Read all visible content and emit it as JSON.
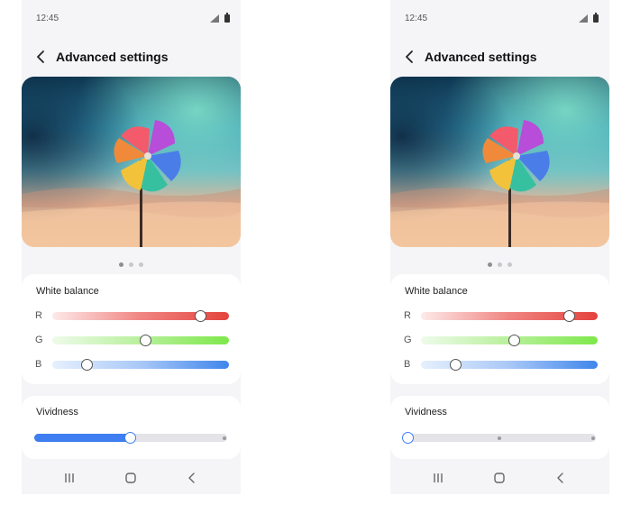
{
  "screens": [
    {
      "id": "left",
      "status_time": "12:45",
      "title": "Advanced settings",
      "white_balance": {
        "label": "White balance",
        "channels": [
          {
            "label": "R",
            "value": 0.84
          },
          {
            "label": "G",
            "value": 0.53
          },
          {
            "label": "B",
            "value": 0.2
          }
        ]
      },
      "vividness": {
        "label": "Vividness",
        "value": 0.5,
        "stops": 2
      }
    },
    {
      "id": "right",
      "status_time": "12:45",
      "title": "Advanced settings",
      "white_balance": {
        "label": "White balance",
        "channels": [
          {
            "label": "R",
            "value": 0.84
          },
          {
            "label": "G",
            "value": 0.53
          },
          {
            "label": "B",
            "value": 0.2
          }
        ]
      },
      "vividness": {
        "label": "Vividness",
        "value": 0.0,
        "stops": 3
      }
    }
  ],
  "pager": {
    "count": 3,
    "active_index": 0
  },
  "icons": {
    "back": "back-arrow-icon",
    "signal": "signal-icon",
    "battery": "battery-icon",
    "nav_recents": "recents-icon",
    "nav_home": "home-icon",
    "nav_back": "back-icon"
  },
  "colors": {
    "accent": "#3e7ef0",
    "red_channel": "#e4433d",
    "green_channel": "#7ee84a",
    "blue_channel": "#3f86ec",
    "background": "#f5f5f7"
  }
}
